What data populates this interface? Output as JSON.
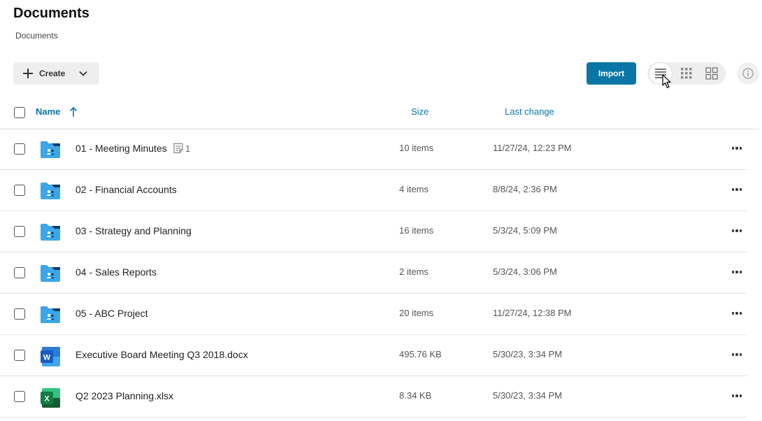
{
  "page": {
    "title": "Documents",
    "breadcrumb": "Documents"
  },
  "toolbar": {
    "create_label": "Create",
    "import_label": "Import",
    "active_view": "list"
  },
  "columns": {
    "name": "Name",
    "size": "Size",
    "last_change": "Last change",
    "sort": "ascending"
  },
  "colors": {
    "accent": "#0a76a8",
    "folder": "#3ba6e8",
    "word": "#185abd",
    "excel": "#107c41"
  },
  "rows": [
    {
      "name": "01 - Meeting Minutes",
      "icon": "shared-folder-icon",
      "size": "10 items",
      "date": "11/27/24, 12:23 PM",
      "note_count": "1"
    },
    {
      "name": "02 - Financial Accounts",
      "icon": "shared-folder-icon",
      "size": "4 items",
      "date": "8/8/24, 2:36 PM"
    },
    {
      "name": "03 - Strategy and Planning",
      "icon": "shared-folder-icon",
      "size": "16 items",
      "date": "5/3/24, 5:09 PM"
    },
    {
      "name": "04 - Sales Reports",
      "icon": "shared-folder-icon",
      "size": "2 items",
      "date": "5/3/24, 3:06 PM"
    },
    {
      "name": "05 - ABC Project",
      "icon": "shared-folder-icon",
      "size": "20 items",
      "date": "11/27/24, 12:38 PM"
    },
    {
      "name": "Executive Board Meeting Q3 2018.docx",
      "icon": "word-doc-icon",
      "size": "495.76 KB",
      "date": "5/30/23, 3:34 PM"
    },
    {
      "name": "Q2 2023 Planning.xlsx",
      "icon": "excel-sheet-icon",
      "size": "8.34 KB",
      "date": "5/30/23, 3:34 PM"
    }
  ]
}
